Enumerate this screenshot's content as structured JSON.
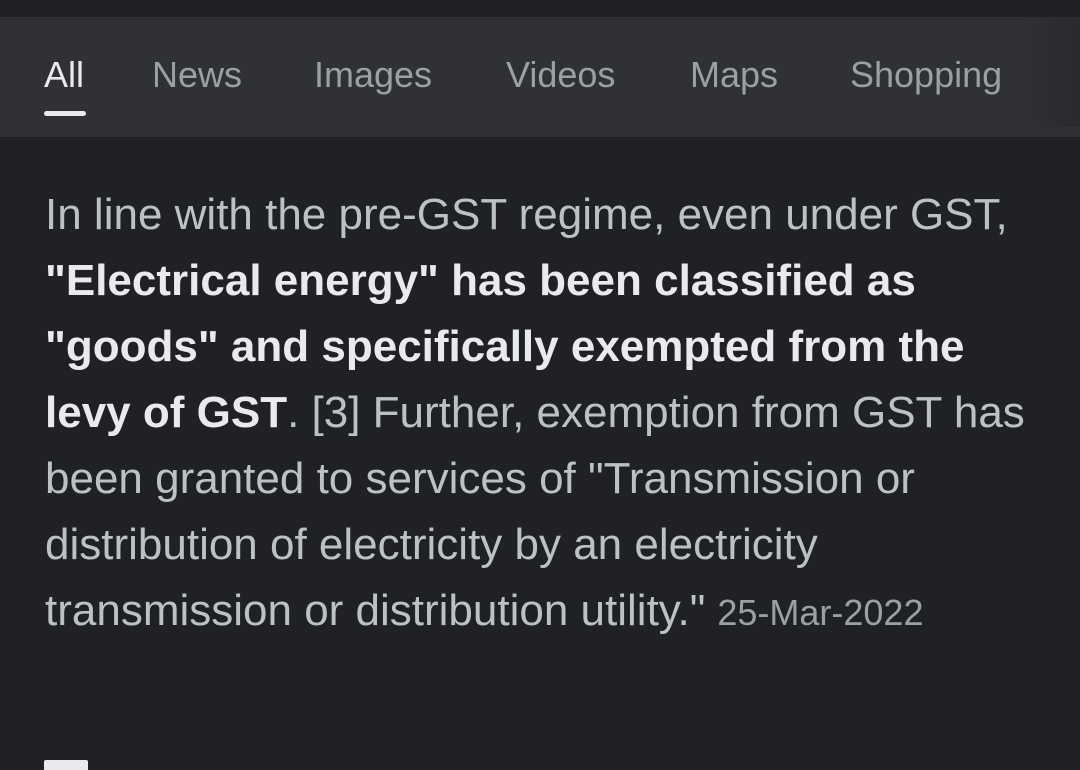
{
  "tabs": [
    {
      "label": "All",
      "active": true
    },
    {
      "label": "News",
      "active": false
    },
    {
      "label": "Images",
      "active": false
    },
    {
      "label": "Videos",
      "active": false
    },
    {
      "label": "Maps",
      "active": false
    },
    {
      "label": "Shopping",
      "active": false
    }
  ],
  "snippet": {
    "part1": "In line with the pre-GST regime, even under GST, ",
    "bold": "\"Electrical energy\" has been classified as \"goods\" and specifically exempted from the levy of GST",
    "part2": ". [3] Further, exemption from GST has been granted to services of \"Transmission or distribution of electricity by an electricity transmission or distribution utility.\"",
    "date": "25-Mar-2022"
  },
  "colors": {
    "background": "#202124",
    "tabbar": "#303134",
    "text": "#bdc1c6",
    "text_bold": "#e8eaed",
    "tab_inactive": "#9aa0a6"
  }
}
